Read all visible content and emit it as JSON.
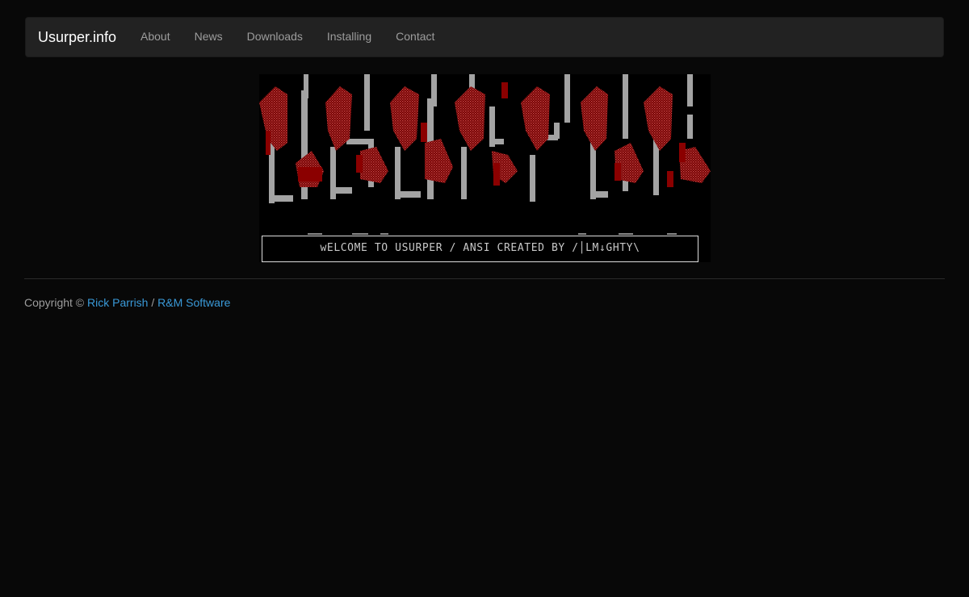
{
  "navbar": {
    "brand": "Usurper.info",
    "links": [
      "About",
      "News",
      "Downloads",
      "Installing",
      "Contact"
    ]
  },
  "banner": {
    "welcome_text": "wELCOME TO USURPER / ANSI CREATED BY /│LM↓GHTY\\"
  },
  "footer": {
    "copyright_prefix": "Copyright ©",
    "author_link": "Rick Parrish",
    "separator": "/",
    "company_link": "R&M Software"
  },
  "colors": {
    "background": "#080808",
    "navbar": "#222222",
    "link": "#3a9ad9",
    "ansi_red": "#8b0000",
    "ansi_gray": "#a0a0a0"
  }
}
